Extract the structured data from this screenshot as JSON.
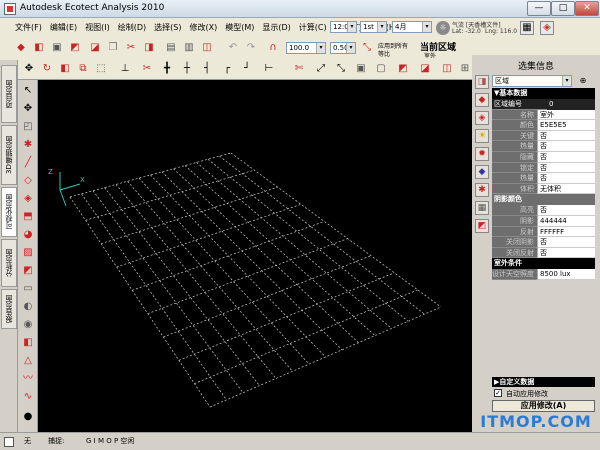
{
  "window": {
    "title": "Autodesk Ecotect Analysis 2010",
    "minimize": "—",
    "maximize": "□",
    "close": "✕"
  },
  "menu": [
    "文件(F)",
    "编辑(E)",
    "视图(I)",
    "绘制(D)",
    "选择(S)",
    "修改(X)",
    "模型(M)",
    "显示(D)",
    "计算(C)",
    "工具(T)",
    "帮助(H)"
  ],
  "toolbar_top": {
    "time": "12:00",
    "day": "1st",
    "month": "4月",
    "weather_title": "气流 [天香槽文件]",
    "lat": "Lat: -32.0",
    "lng": "Lng: 116.0",
    "scale_value": "100.0",
    "angle_value": "0.50",
    "apply_label_line1": "应用到所有",
    "apply_label_line2": "等比",
    "current_zone": "当前区域",
    "zone_name": "室外"
  },
  "left_tabs": [
    "项目页面",
    "3D编辑页面",
    "可视化页面",
    "分析页面",
    "报告页面"
  ],
  "panel": {
    "title": "选集信息",
    "zone_select": "区域",
    "section_basic": "▼基本数据",
    "zone_no_label": "区域编号",
    "zone_no_value": "0",
    "basic_rows": [
      {
        "k": "名称",
        "v": "室外"
      },
      {
        "k": "颜色",
        "v": "E5E5E5"
      },
      {
        "k": "关键",
        "v": "否"
      },
      {
        "k": "热量",
        "v": "否"
      },
      {
        "k": "隐藏",
        "v": "否"
      },
      {
        "k": "锁定",
        "v": "否"
      },
      {
        "k": "热量",
        "v": "否"
      },
      {
        "k": "体积",
        "v": "无体积"
      }
    ],
    "section_shadow": "阴影颜色",
    "shadow_rows": [
      {
        "k": "高亮",
        "v": "否"
      },
      {
        "k": "阴影",
        "v": "444444"
      },
      {
        "k": "反射",
        "v": "FFFFFF"
      },
      {
        "k": "关闭阴影",
        "v": "否"
      },
      {
        "k": "关闭反射",
        "v": "否"
      }
    ],
    "section_outdoor": "室外条件",
    "outdoor_rows": [
      {
        "k": "设计天空照度",
        "v": "8500 lux"
      }
    ],
    "section_custom": "▶自定义数据",
    "auto_apply": "自动应用修改",
    "apply_button": "应用修改(A)"
  },
  "status": {
    "mode": "无",
    "capture": "捕捉:",
    "flags": "G I   M O P   空闲"
  },
  "watermark": "ITMOP.COM"
}
